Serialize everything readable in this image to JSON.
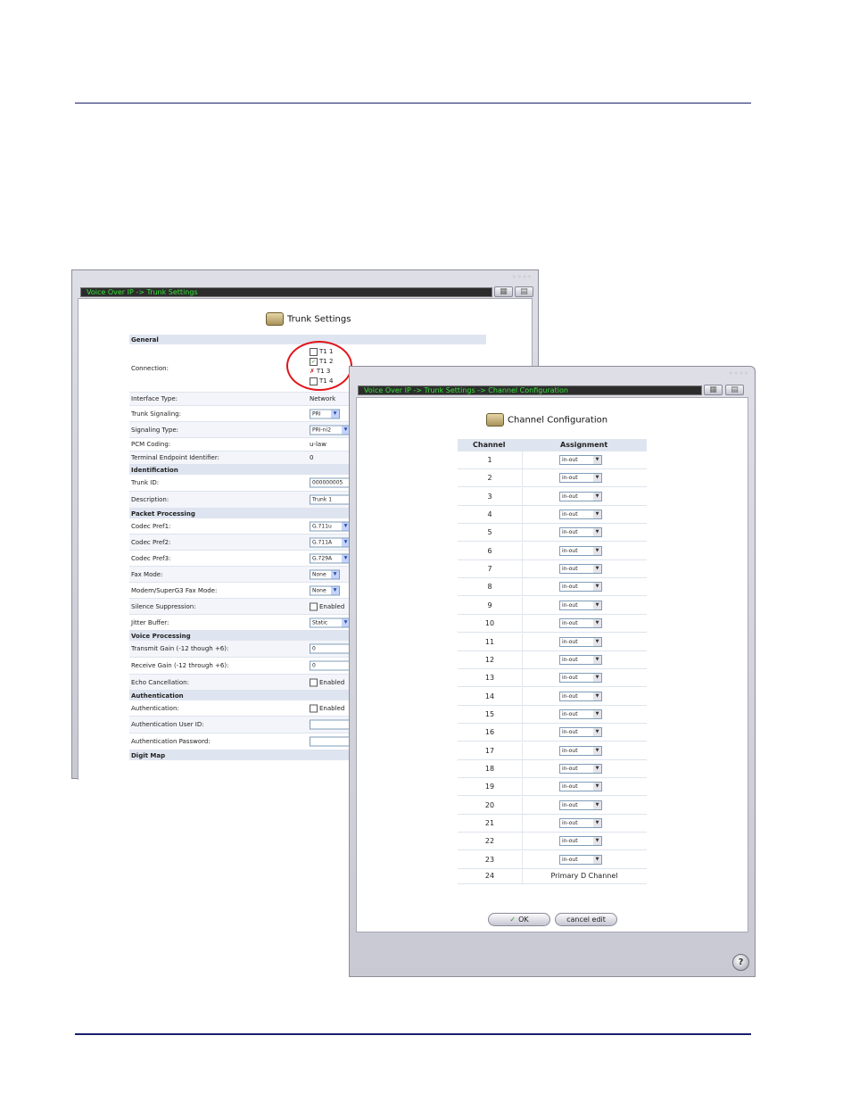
{
  "back_window": {
    "breadcrumb": "Voice Over IP -> Trunk Settings",
    "title": "Trunk Settings",
    "rows": [
      {
        "type": "section",
        "label": "General"
      },
      {
        "type": "connection",
        "label": "Connection:"
      },
      {
        "type": "text",
        "label": "Interface Type:",
        "value": "Network"
      },
      {
        "type": "select",
        "label": "Trunk Signaling:",
        "value": "PRI"
      },
      {
        "type": "select",
        "label": "Signaling Type:",
        "value": "PRI-ni2"
      },
      {
        "type": "text",
        "label": "PCM Coding:",
        "value": "u-law"
      },
      {
        "type": "text",
        "label": "Terminal Endpoint Identifier:",
        "value": "0"
      },
      {
        "type": "section",
        "label": "Identification"
      },
      {
        "type": "input",
        "label": "Trunk ID:",
        "value": "000000005"
      },
      {
        "type": "input",
        "label": "Description:",
        "value": "Trunk 1"
      },
      {
        "type": "section",
        "label": "Packet Processing"
      },
      {
        "type": "select",
        "label": "Codec Pref1:",
        "value": "G.711u"
      },
      {
        "type": "select",
        "label": "Codec Pref2:",
        "value": "G.711A"
      },
      {
        "type": "select",
        "label": "Codec Pref3:",
        "value": "G.729A"
      },
      {
        "type": "select",
        "label": "Fax Mode:",
        "value": "None"
      },
      {
        "type": "select",
        "label": "Modem/SuperG3 Fax Mode:",
        "value": "None"
      },
      {
        "type": "checkbox",
        "label": "Silence Suppression:",
        "value": "Enabled"
      },
      {
        "type": "select",
        "label": "Jitter Buffer:",
        "value": "Static"
      },
      {
        "type": "section",
        "label": "Voice Processing"
      },
      {
        "type": "input",
        "label": "Transmit Gain (-12 though +6):",
        "value": "0"
      },
      {
        "type": "input",
        "label": "Receive Gain (-12 through +6):",
        "value": "0"
      },
      {
        "type": "checkbox",
        "label": "Echo Cancellation:",
        "value": "Enabled"
      },
      {
        "type": "section",
        "label": "Authentication"
      },
      {
        "type": "checkbox",
        "label": "Authentication:",
        "value": "Enabled"
      },
      {
        "type": "input",
        "label": "Authentication User ID:",
        "value": ""
      },
      {
        "type": "input",
        "label": "Authentication Password:",
        "value": ""
      },
      {
        "type": "section",
        "label": "Digit Map"
      }
    ],
    "connection": [
      {
        "label": "T1 1",
        "state": "unchecked"
      },
      {
        "label": "T1 2",
        "state": "checked"
      },
      {
        "label": "T1 3",
        "state": "disabled"
      },
      {
        "label": "T1 4",
        "state": "unchecked"
      }
    ]
  },
  "front_window": {
    "breadcrumb": "Voice Over IP -> Trunk Settings -> Channel Configuration",
    "title": "Channel Configuration",
    "col_channel": "Channel",
    "col_assignment": "Assignment",
    "channels": [
      {
        "num": "1",
        "assign": "in-out"
      },
      {
        "num": "2",
        "assign": "in-out"
      },
      {
        "num": "3",
        "assign": "in-out"
      },
      {
        "num": "4",
        "assign": "in-out"
      },
      {
        "num": "5",
        "assign": "in-out"
      },
      {
        "num": "6",
        "assign": "in-out"
      },
      {
        "num": "7",
        "assign": "in-out"
      },
      {
        "num": "8",
        "assign": "in-out"
      },
      {
        "num": "9",
        "assign": "in-out"
      },
      {
        "num": "10",
        "assign": "in-out"
      },
      {
        "num": "11",
        "assign": "in-out"
      },
      {
        "num": "12",
        "assign": "in-out"
      },
      {
        "num": "13",
        "assign": "in-out"
      },
      {
        "num": "14",
        "assign": "in-out"
      },
      {
        "num": "15",
        "assign": "in-out"
      },
      {
        "num": "16",
        "assign": "in-out"
      },
      {
        "num": "17",
        "assign": "in-out"
      },
      {
        "num": "18",
        "assign": "in-out"
      },
      {
        "num": "19",
        "assign": "in-out"
      },
      {
        "num": "20",
        "assign": "in-out"
      },
      {
        "num": "21",
        "assign": "in-out"
      },
      {
        "num": "22",
        "assign": "in-out"
      },
      {
        "num": "23",
        "assign": "in-out"
      }
    ],
    "last_channel": {
      "num": "24",
      "assign": "Primary D Channel"
    },
    "ok_label": "OK",
    "cancel_label": "cancel edit",
    "help_glyph": "?"
  },
  "icons": [
    "trunk-settings-icon",
    "channel-configuration-icon",
    "window-restore-icon",
    "window-maximize-icon",
    "help-icon",
    "checkmark-icon"
  ]
}
